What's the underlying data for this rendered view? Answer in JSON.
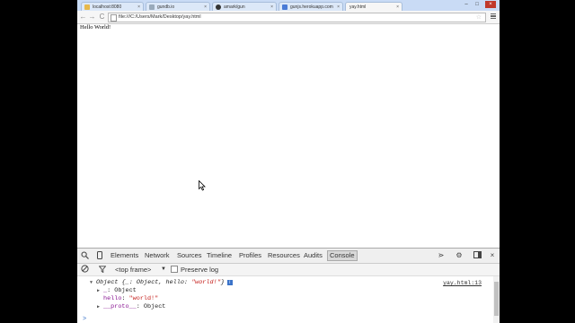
{
  "tabs": [
    {
      "label": "localhost:8080",
      "active": false
    },
    {
      "label": "gundb.io",
      "active": false
    },
    {
      "label": "amark/gun",
      "active": false
    },
    {
      "label": "gunjs.herokuapp.com",
      "active": false
    },
    {
      "label": "yay.html",
      "active": true
    }
  ],
  "window_controls": {
    "minimize": "–",
    "maximize": "□",
    "close": "×"
  },
  "toolbar": {
    "back": "←",
    "forward": "→",
    "reload": "C",
    "url": "file:///C:/Users/Mark/Desktop/yay.html"
  },
  "page": {
    "text": "Hello World!"
  },
  "devtools": {
    "tabs": [
      "Elements",
      "Network",
      "Sources",
      "Timeline",
      "Profiles",
      "Resources",
      "Audits",
      "Console"
    ],
    "active_tab": "Console",
    "frame_select": "<top frame>",
    "preserve_log": "Preserve log",
    "console": {
      "object_summary_prefix": "Object {",
      "object_summary_mid": "_: Object, hello: ",
      "object_summary_str": "\"world!\"",
      "object_summary_suffix": "}",
      "source_link": "yay.html:13",
      "row1_key": "_",
      "row1_val": ": Object",
      "row2_key": "hello",
      "row2_val": "\"world!\"",
      "row3_key": "__proto__",
      "row3_val": ": Object",
      "prompt": ">"
    }
  }
}
